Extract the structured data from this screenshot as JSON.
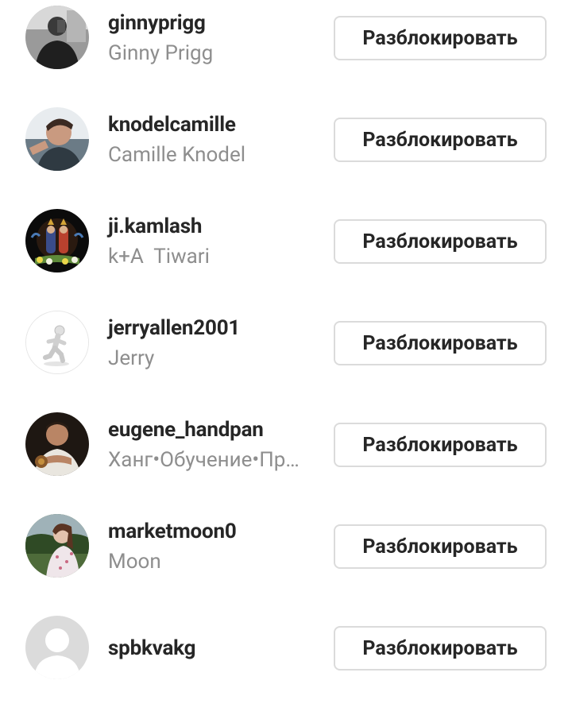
{
  "blocked_users": [
    {
      "username": "ginnyprigg",
      "full_name": "Ginny Prigg",
      "unblock_label": "Разблокировать",
      "avatar_icon": "photo-avatar-icon"
    },
    {
      "username": "knodelcamille",
      "full_name": "Camille Knodel",
      "unblock_label": "Разблокировать",
      "avatar_icon": "photo-avatar-icon"
    },
    {
      "username": "ji.kamlash",
      "full_name": "k+A  Tiwari",
      "unblock_label": "Разблокировать",
      "avatar_icon": "photo-avatar-icon"
    },
    {
      "username": "jerryallen2001",
      "full_name": "Jerry",
      "unblock_label": "Разблокировать",
      "avatar_icon": "running-figure-avatar-icon"
    },
    {
      "username": "eugene_handpan",
      "full_name": "Ханг•Обучение•Пр…",
      "unblock_label": "Разблокировать",
      "avatar_icon": "photo-avatar-icon"
    },
    {
      "username": "marketmoon0",
      "full_name": "Moon",
      "unblock_label": "Разблокировать",
      "avatar_icon": "photo-avatar-icon"
    },
    {
      "username": "spbkvakg",
      "full_name": "",
      "unblock_label": "Разблокировать",
      "avatar_icon": "default-user-avatar-icon"
    }
  ],
  "colors": {
    "username": "#262626",
    "full_name": "#8e8e8e",
    "button_border": "#dbdbdb",
    "background": "#ffffff"
  }
}
